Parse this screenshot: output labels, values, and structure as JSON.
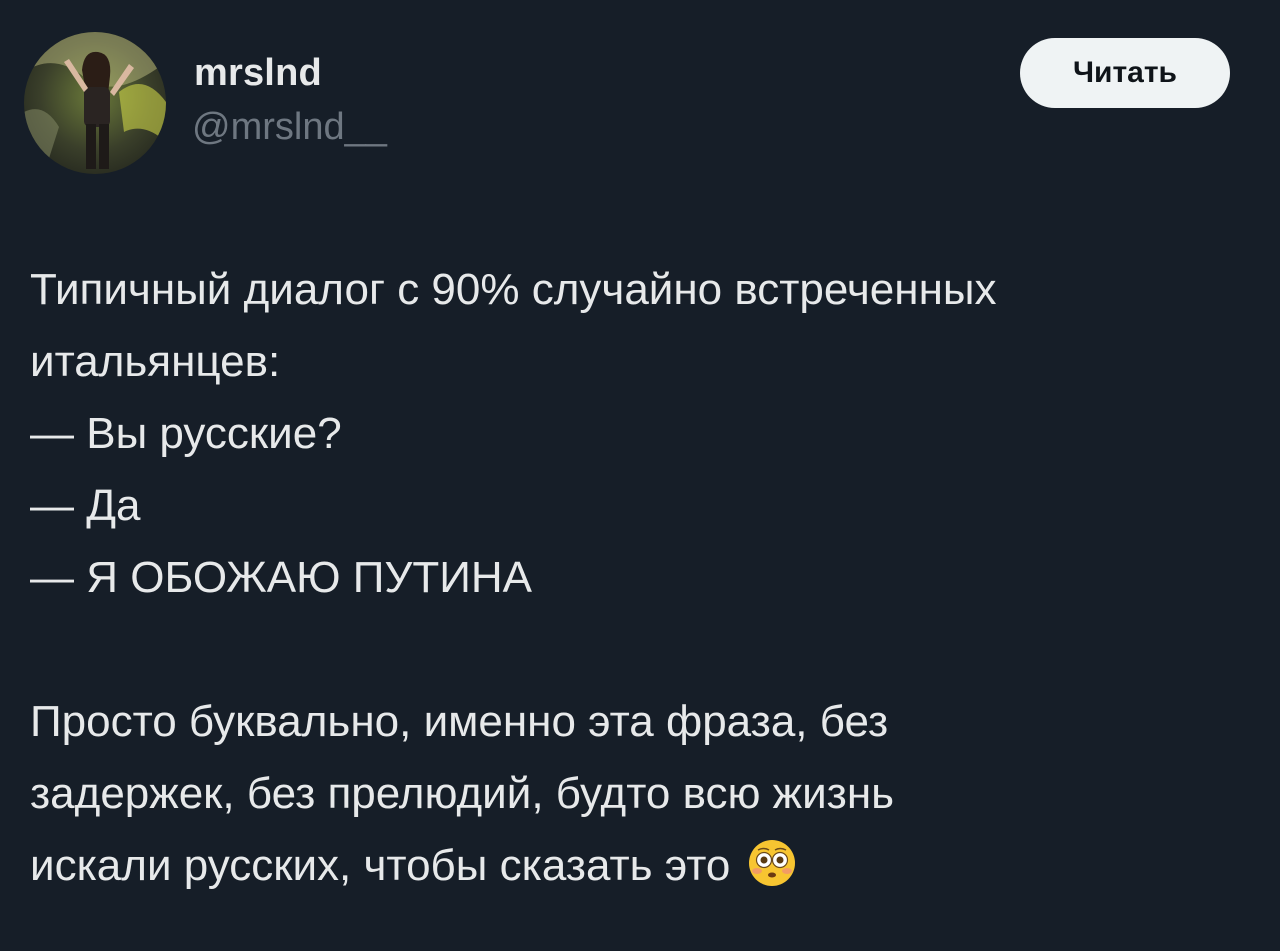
{
  "author": {
    "display_name": "mrslnd",
    "handle": "@mrslnd__"
  },
  "follow_button": {
    "label": "Читать"
  },
  "tweet": {
    "lines": [
      "Типичный диалог с 90% случайно встреченных",
      "итальянцев:",
      "— Вы русские?",
      "— Да",
      "— Я ОБОЖАЮ ПУТИНА",
      "",
      "Просто буквально, именно эта фраза, без",
      "задержек, без прелюдий, будто всю жизнь",
      "искали русских, чтобы сказать это"
    ],
    "trailing_emoji": "flushed-face-emoji"
  },
  "colors": {
    "background": "#161e28",
    "text": "#e7e9ea",
    "secondary_text": "#6e7781",
    "button_bg": "#eff3f4",
    "button_text": "#0f1419"
  }
}
